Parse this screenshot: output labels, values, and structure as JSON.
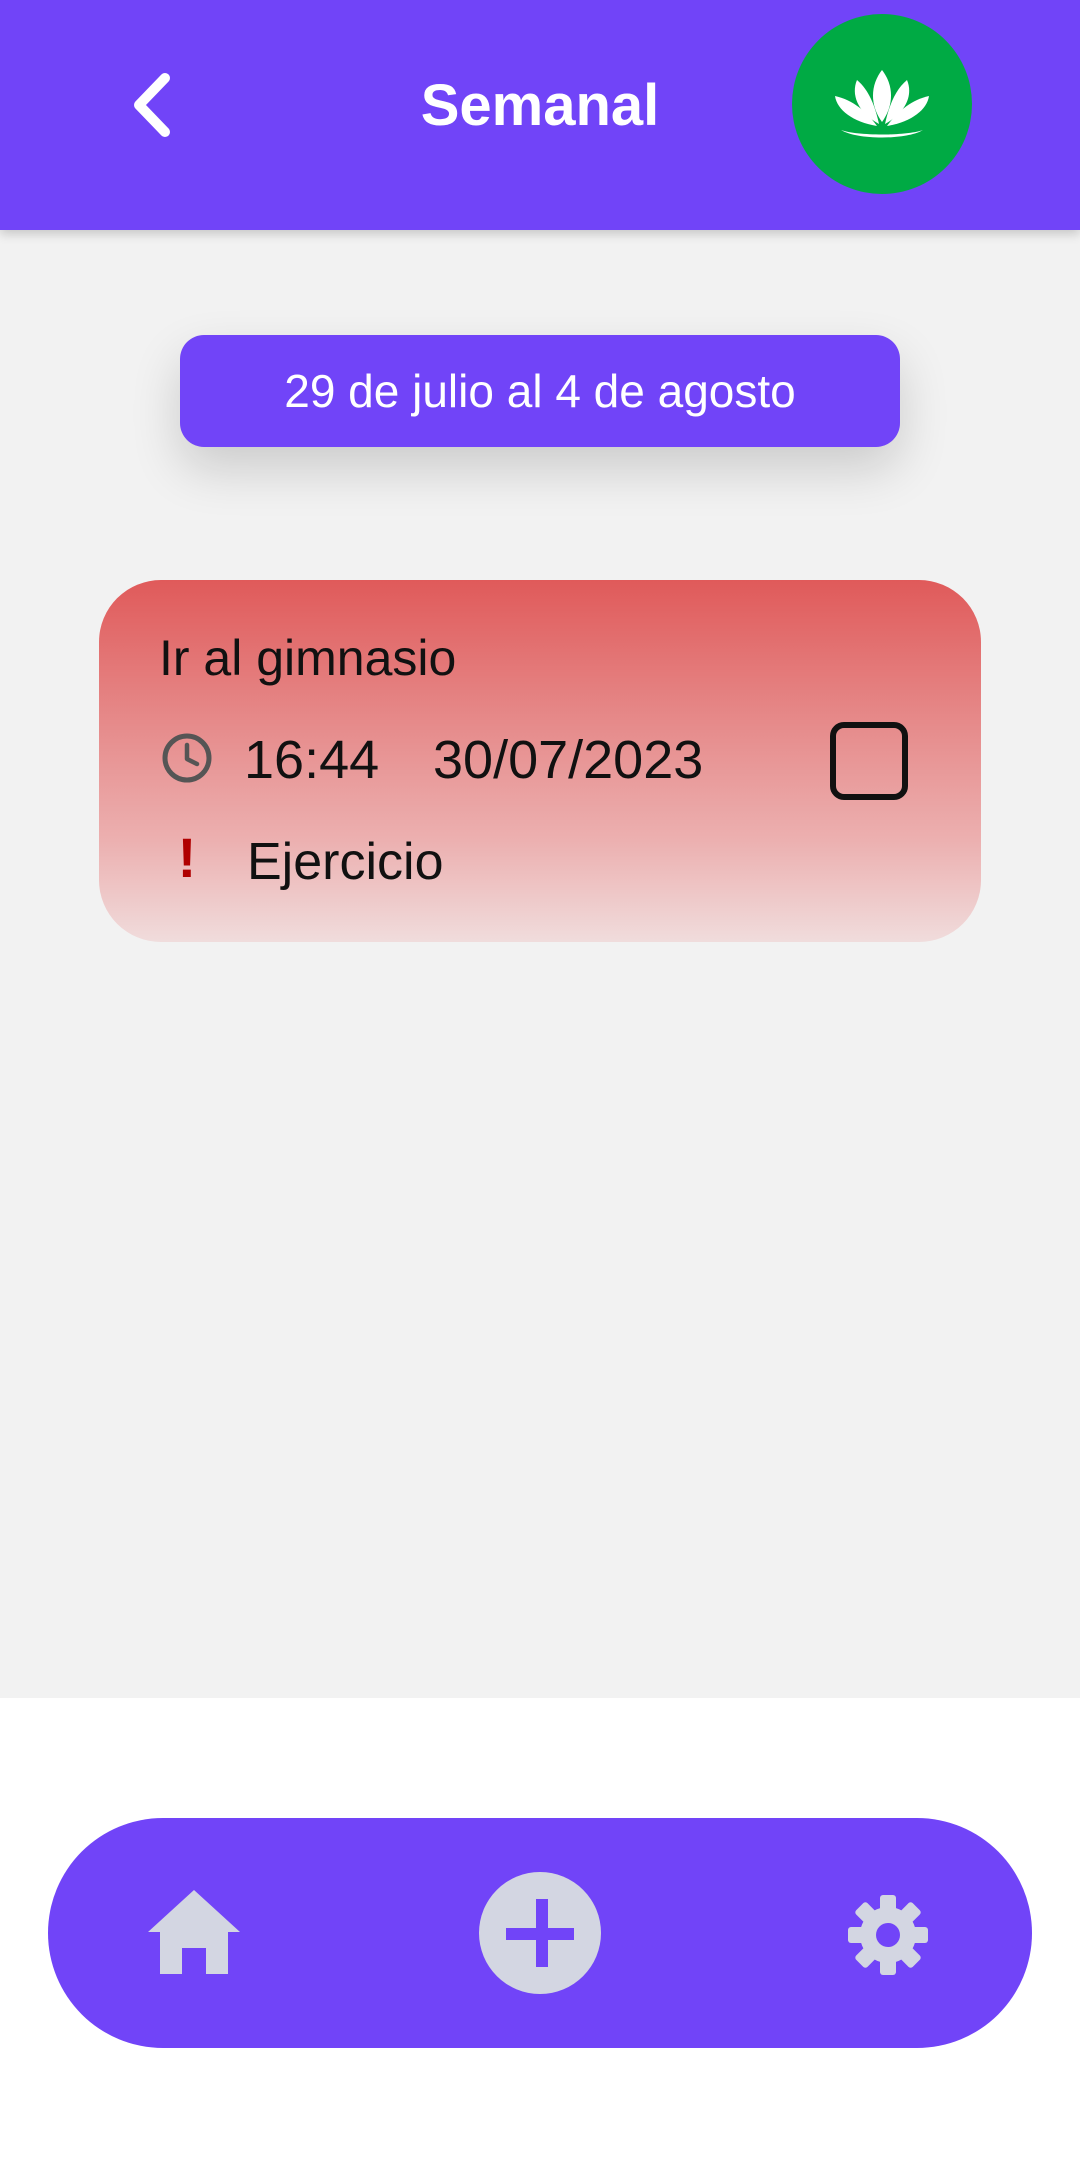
{
  "header": {
    "title": "Semanal",
    "back_icon": "chevron-left-icon",
    "logo_icon": "lotus-icon"
  },
  "week": {
    "range": "29 de julio al 4 de agosto"
  },
  "tasks": [
    {
      "title": "Ir al gimnasio",
      "time": "16:44",
      "date": "30/07/2023",
      "priority_icon": "!",
      "category": "Ejercicio",
      "checked": false
    }
  ],
  "nav": {
    "home_icon": "home-icon",
    "add_icon": "plus-icon",
    "settings_icon": "gear-icon"
  },
  "colors": {
    "primary": "#7144f8",
    "logo_background": "#00aa44",
    "task_card_top": "#e05a5a",
    "task_card_bottom": "#f0dcdc",
    "content_background": "#f2f2f2",
    "priority_red": "#b00000",
    "nav_icon": "#d3d6e2"
  }
}
